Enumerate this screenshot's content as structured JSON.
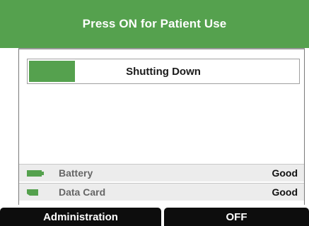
{
  "header": {
    "title": "Press ON for Patient Use"
  },
  "progress": {
    "label": "Shutting Down",
    "fraction": 0.17,
    "color": "#55a14e"
  },
  "status": [
    {
      "icon": "battery-icon",
      "label": "Battery",
      "value": "Good"
    },
    {
      "icon": "data-card-icon",
      "label": "Data Card",
      "value": "Good"
    }
  ],
  "buttons": {
    "administration_label": "Administration",
    "off_label": "OFF"
  },
  "colors": {
    "accent": "#55a14e",
    "button_bg": "#0d0d0d",
    "status_row_bg": "#ececec"
  }
}
